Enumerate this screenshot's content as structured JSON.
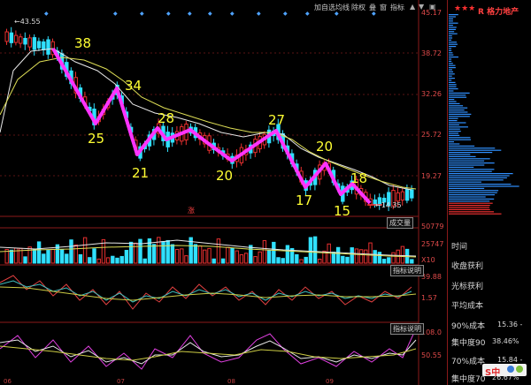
{
  "toolbar": {
    "buttons": [
      "加自选",
      "均线",
      "除权",
      "叠",
      "窗",
      "指标"
    ],
    "icon_names": [
      "up-arrow-icon",
      "down-arrow-icon",
      "window-icon"
    ]
  },
  "stock": {
    "title": "R 格力地产",
    "stars": "★★★",
    "high_price_label": "43.55",
    "low_price_label": "14.35",
    "event_marker": "涨"
  },
  "price_axis": [
    "45.17",
    "38.72",
    "32.26",
    "25.72",
    "19.27"
  ],
  "volume_axis": [
    "50779",
    "25747",
    "X10"
  ],
  "indicator1_axis": [
    "39.88",
    "1.57"
  ],
  "indicator2_axis": [
    "108.0",
    "50.55"
  ],
  "buttons": {
    "volume": "成交量",
    "indicator_note_1": "指标说明",
    "indicator_note_2": "指标说明"
  },
  "annotations": [
    "38",
    "34",
    "25",
    "21",
    "28",
    "20",
    "27",
    "20",
    "17",
    "18",
    "15"
  ],
  "months": [
    "06",
    "07",
    "08",
    "09"
  ],
  "right_panel": {
    "rows": [
      {
        "label": "时间",
        "value": ""
      },
      {
        "label": "收盘获利",
        "value": ""
      },
      {
        "label": "光标获利",
        "value": ""
      },
      {
        "label": "平均成本",
        "value": ""
      },
      {
        "label": "90%成本",
        "value": "15.36 -"
      },
      {
        "label": "集中度90",
        "value": "38.46%"
      },
      {
        "label": "70%成本",
        "value": "15.84 -"
      },
      {
        "label": "集中度70",
        "value": "26.67%"
      }
    ]
  },
  "logo_text": "S中",
  "colors": {
    "background": "#000000",
    "up_candle": "#e83030",
    "down_candle": "#30e0ff",
    "annotation_line": "#ff33ff",
    "annotation_text": "#ffff33",
    "ma_line": "#ffffff",
    "ma_line_2": "#ffff66"
  }
}
